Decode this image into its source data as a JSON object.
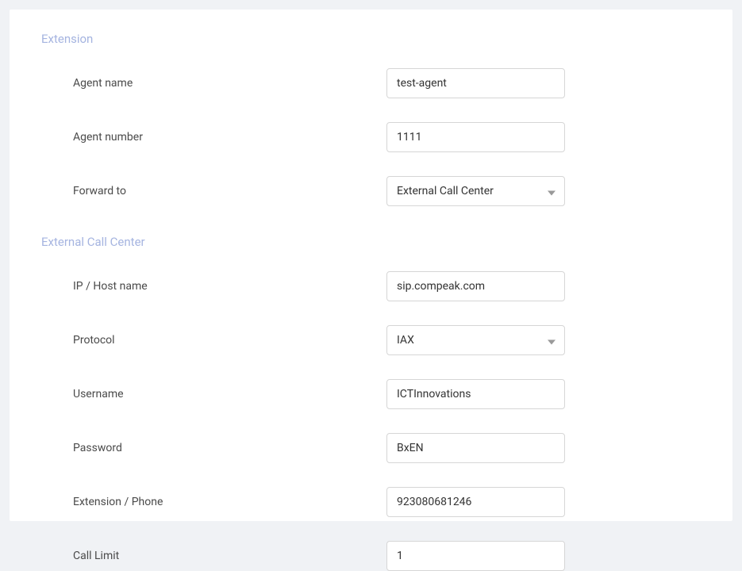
{
  "sections": {
    "extension": {
      "title": "Extension",
      "fields": {
        "agent_name": {
          "label": "Agent name",
          "value": "test-agent"
        },
        "agent_number": {
          "label": "Agent number",
          "value": "1111"
        },
        "forward_to": {
          "label": "Forward to",
          "value": "External Call Center"
        }
      }
    },
    "external_call_center": {
      "title": "External Call Center",
      "fields": {
        "ip_host": {
          "label": "IP / Host name",
          "value": "sip.compeak.com"
        },
        "protocol": {
          "label": "Protocol",
          "value": "IAX"
        },
        "username": {
          "label": "Username",
          "value": "ICTInnovations"
        },
        "password": {
          "label": "Password",
          "value": "BxEN"
        },
        "extension_phone": {
          "label": "Extension / Phone",
          "value": "923080681246"
        },
        "call_limit": {
          "label": "Call Limit",
          "value": "1"
        }
      }
    }
  }
}
